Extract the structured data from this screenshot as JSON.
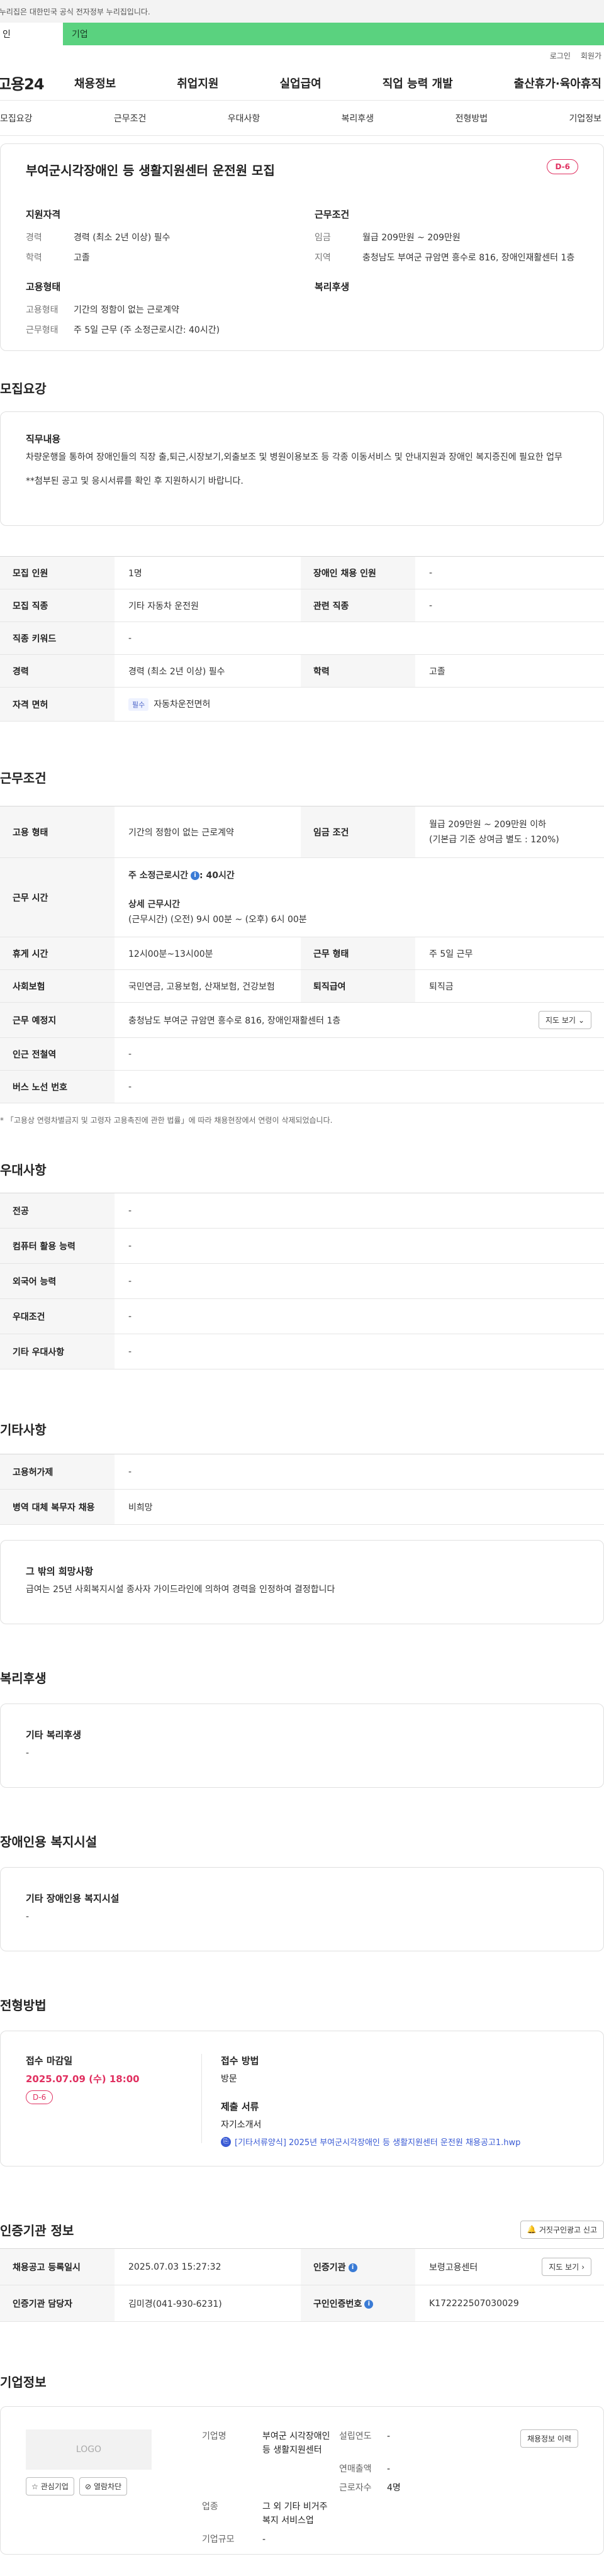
{
  "gov_banner": "이 누리집은 대한민국 공식 전자정부 누리집입니다.",
  "type_tabs": [
    "인",
    "기업"
  ],
  "util": [
    "로그인",
    "회원가"
  ],
  "logo": "고용24",
  "gnb": [
    "채용정보",
    "취업지원",
    "실업급여",
    "직업 능력 개발",
    "출산휴가·육아휴직"
  ],
  "anchor_tabs": [
    "모집요강",
    "근무조건",
    "우대사항",
    "복리후생",
    "전형방법",
    "기업정보"
  ],
  "summary": {
    "title": "부여군시각장애인 등 생활지원센터 운전원 모집",
    "dday": "D-6",
    "qual_title": "지원자격",
    "career_k": "경력",
    "career_v": "경력 (최소 2년 이상) 필수",
    "edu_k": "학력",
    "edu_v": "고졸",
    "cond_title": "근무조건",
    "wage_k": "임금",
    "wage_v": "월급 209만원 ~ 209만원",
    "region_k": "지역",
    "region_v": "충청남도 부여군 규암면 흥수로 816, 장애인재활센터 1층",
    "emp_title": "고용형태",
    "emptype_k": "고용형태",
    "emptype_v": "기간의 정함이 없는 근로계약",
    "worktype_k": "근무형태",
    "worktype_v": "주 5일 근무 (주 소정근로시간: 40시간)",
    "welfare_title": "복리후생"
  },
  "recruit": {
    "title": "모집요강",
    "duty_title": "직무내용",
    "duty_text": "차량운행을 통하여 장애인들의 직장 출,퇴근,시장보기,외출보조 및 병원이용보조 등 각종 이동서비스 및 안내지원과 장애인 복지증진에 필요한 업무",
    "duty_note": "**첨부된 공고 및 응시서류를 확인 후 지원하시기 바랍니다.",
    "rows": {
      "count_k": "모집 인원",
      "count_v": "1명",
      "disabled_k": "장애인 채용 인원",
      "disabled_v": "-",
      "job_k": "모집 직종",
      "job_v": "기타 자동차 운전원",
      "related_k": "관련 직종",
      "related_v": "-",
      "keyword_k": "직종 키워드",
      "keyword_v": "-",
      "career_k": "경력",
      "career_v": "경력 (최소 2년 이상) 필수",
      "edu_k": "학력",
      "edu_v": "고졸",
      "license_k": "자격 면허",
      "license_chip": "필수",
      "license_v": "자동차운전면허"
    }
  },
  "work": {
    "title": "근무조건",
    "emp_k": "고용 형태",
    "emp_v": "기간의 정함이 없는 근로계약",
    "wage_k": "임금 조건",
    "wage_v1": "월급 209만원 ~ 209만원 이하",
    "wage_v2": "(기본급 기준 상여금 별도 : 120%)",
    "hours_k": "근무 시간",
    "hours_weekly_label": "주 소정근로시간",
    "hours_weekly_v": ": 40시간",
    "hours_detail_label": "상세 근무시간",
    "hours_detail_v": "(근무시간) (오전) 9시 00분 ~ (오후) 6시 00분",
    "break_k": "휴게 시간",
    "break_v": "12시00분~13시00분",
    "form_k": "근무 형태",
    "form_v": "주 5일 근무",
    "insurance_k": "사회보험",
    "insurance_v": "국민연금, 고용보험, 산재보험, 건강보험",
    "severance_k": "퇴직급여",
    "severance_v": "퇴직금",
    "place_k": "근무 예정지",
    "place_v": "충청남도 부여군 규암면 흥수로 816, 장애인재활센터 1층",
    "map_btn": "지도 보기",
    "station_k": "인근 전철역",
    "station_v": "-",
    "bus_k": "버스 노선 번호",
    "bus_v": "-",
    "note": "* 「고용상 연령차별금지 및 고령자 고용촉진에 관한 법률」에 따라 채용현장에서 연령이 삭제되었습니다."
  },
  "pref": {
    "title": "우대사항",
    "major_k": "전공",
    "major_v": "-",
    "computer_k": "컴퓨터 활용 능력",
    "computer_v": "-",
    "lang_k": "외국어 능력",
    "lang_v": "-",
    "cond_k": "우대조건",
    "cond_v": "-",
    "etc_k": "기타 우대사항",
    "etc_v": "-"
  },
  "other": {
    "title": "기타사항",
    "foreign_k": "고용허가제",
    "foreign_v": "-",
    "military_k": "병역 대체 복무자 채용",
    "military_v": "비희망",
    "wish_title": "그 밖의 희망사항",
    "wish_text": "급여는 25년 사회복지시설 종사자 가이드라인에 의하여 경력을 인정하여 결정합니다"
  },
  "welfare": {
    "title": "복리후생",
    "box_title": "기타 복리후생",
    "box_v": "-"
  },
  "facility": {
    "title": "장애인용 복지시설",
    "box_title": "기타 장애인용 복지시설",
    "box_v": "-"
  },
  "process": {
    "title": "전형방법",
    "deadline_title": "접수 마감일",
    "deadline_v": "2025.07.09 (수) 18:00",
    "dday": "D-6",
    "method_title": "접수 방법",
    "method_v": "방문",
    "docs_title": "제출 서류",
    "docs_v": "자기소개서",
    "attach": "[기타서류양식] 2025년 부여군시각장애인 등 생활지원센터 운전원 채용공고1.hwp"
  },
  "cert": {
    "title": "인증기관 정보",
    "report_btn": "거짓구인광고 신고",
    "reg_k": "채용공고 등록일시",
    "reg_v": "2025.07.03 15:27:32",
    "agency_k": "인증기관",
    "agency_v": "보령고용센터",
    "map_btn": "지도 보기",
    "staff_k": "인증기관 담당자",
    "staff_v": "김미경(041-930-6231)",
    "cert_no_k": "구인인증번호",
    "cert_no_v": "K172222507030029"
  },
  "company": {
    "title": "기업정보",
    "logo_text": "LOGO",
    "fav_btn": "관심기업",
    "block_btn": "열람차단",
    "history_btn": "채용정보 이력",
    "name_k": "기업명",
    "name_v": "부여군 시각장애인 등 생활지원센터",
    "year_k": "설립연도",
    "year_v": "-",
    "sales_k": "연매출액",
    "sales_v": "-",
    "emp_k": "근로자수",
    "emp_v": "4명",
    "industry_k": "업종",
    "industry_v": "그 외 기타 비거주 복지 서비스업",
    "scale_k": "기업규모",
    "scale_v": "-"
  }
}
